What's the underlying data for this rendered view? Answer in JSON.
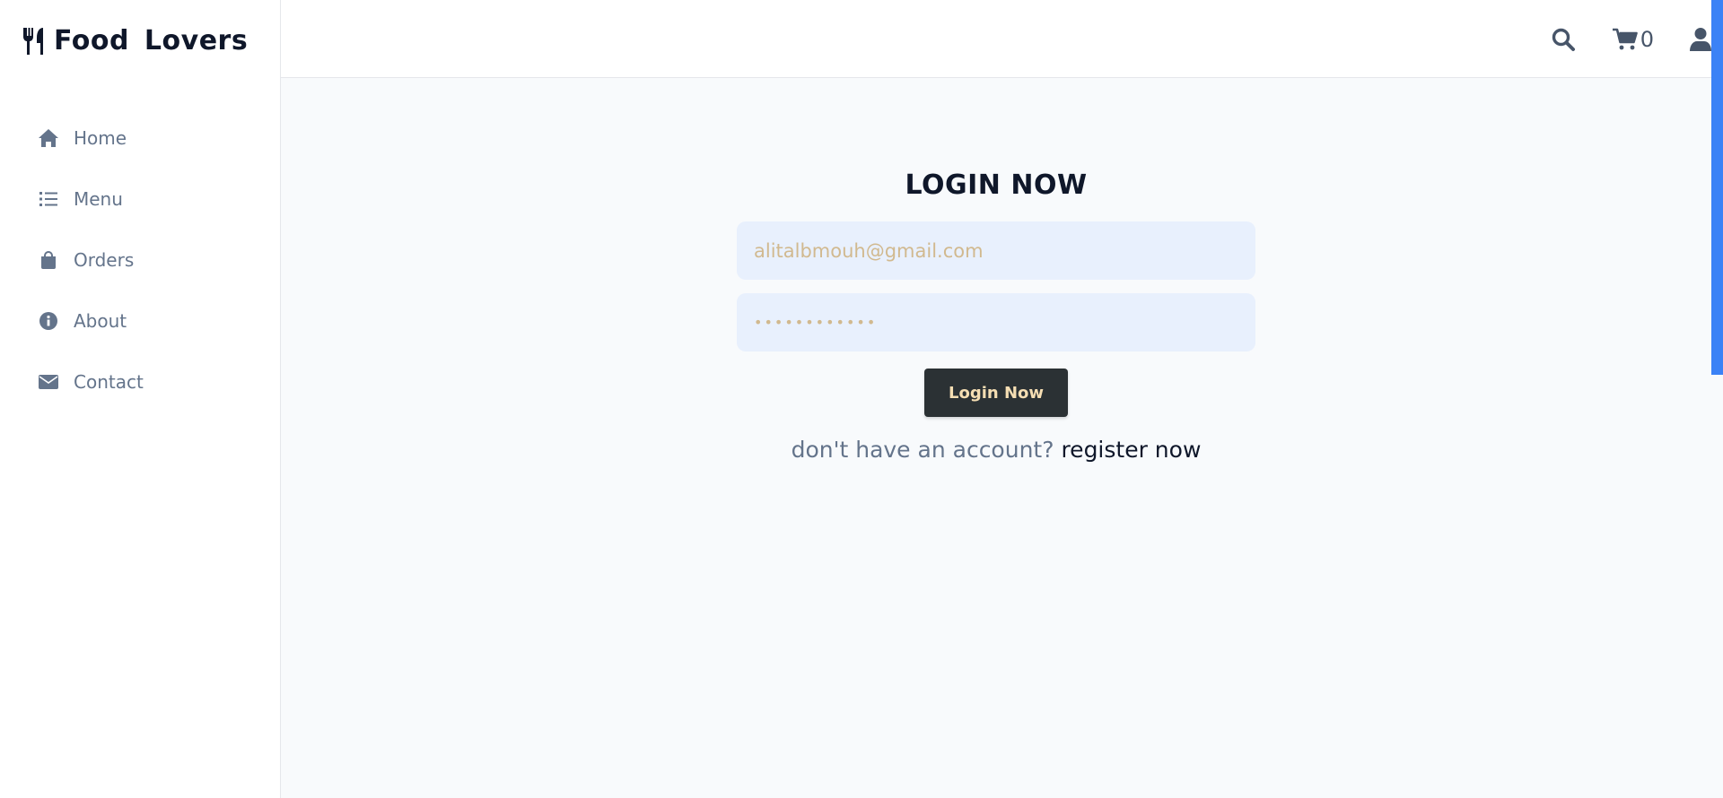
{
  "brand": {
    "name": "Food Lovers"
  },
  "sidebar": {
    "items": [
      {
        "label": "Home",
        "icon": "home-icon"
      },
      {
        "label": "Menu",
        "icon": "list-icon"
      },
      {
        "label": "Orders",
        "icon": "shopping-bag-icon"
      },
      {
        "label": "About",
        "icon": "info-icon"
      },
      {
        "label": "Contact",
        "icon": "envelope-icon"
      }
    ]
  },
  "header": {
    "cart_count": "0",
    "icons": [
      "search-icon",
      "cart-icon",
      "user-icon"
    ]
  },
  "login": {
    "title": "LOGIN NOW",
    "email_value": "alitalbmouh@gmail.com",
    "password_value": "••••••••••••",
    "button_label": "Login Now",
    "register_prompt": "don't have an account?",
    "register_link": "register now"
  },
  "colors": {
    "accent": "#3b82f6",
    "button_bg": "#2b3134",
    "button_text": "#f5deb3",
    "input_bg": "#e8f0fd",
    "nav_text": "#64748b",
    "heading": "#0f172a"
  }
}
